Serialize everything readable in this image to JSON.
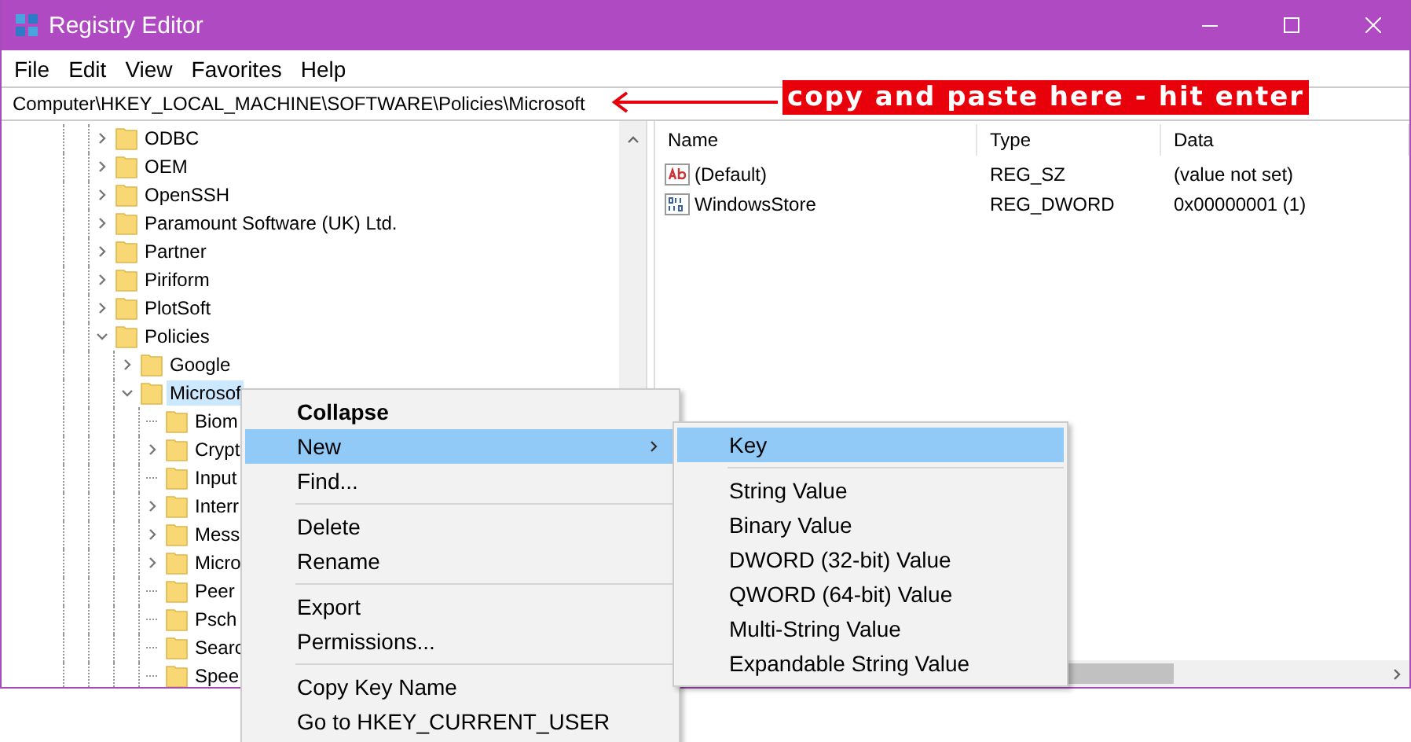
{
  "window": {
    "title": "Registry Editor"
  },
  "menu": [
    "File",
    "Edit",
    "View",
    "Favorites",
    "Help"
  ],
  "address": {
    "value": "Computer\\HKEY_LOCAL_MACHINE\\SOFTWARE\\Policies\\Microsoft"
  },
  "annotation": {
    "text": "copy and paste here - hit enter"
  },
  "tree": [
    {
      "label": "ODBC",
      "expandable": true,
      "expanded": false,
      "selected": false
    },
    {
      "label": "OEM",
      "expandable": true,
      "expanded": false,
      "selected": false
    },
    {
      "label": "OpenSSH",
      "expandable": true,
      "expanded": false,
      "selected": false
    },
    {
      "label": "Paramount Software (UK) Ltd.",
      "expandable": true,
      "expanded": false,
      "selected": false
    },
    {
      "label": "Partner",
      "expandable": true,
      "expanded": false,
      "selected": false
    },
    {
      "label": "Piriform",
      "expandable": true,
      "expanded": false,
      "selected": false
    },
    {
      "label": "PlotSoft",
      "expandable": true,
      "expanded": false,
      "selected": false
    },
    {
      "label": "Policies",
      "expandable": true,
      "expanded": true,
      "selected": false,
      "children": [
        {
          "label": "Google",
          "expandable": true,
          "expanded": false,
          "selected": false
        },
        {
          "label": "Microsof",
          "expandable": true,
          "expanded": true,
          "selected": true,
          "children": [
            {
              "label": "Biom",
              "expandable": false,
              "expanded": false,
              "selected": false
            },
            {
              "label": "Crypt",
              "expandable": true,
              "expanded": false,
              "selected": false
            },
            {
              "label": "Input",
              "expandable": false,
              "expanded": false,
              "selected": false
            },
            {
              "label": "Interr",
              "expandable": true,
              "expanded": false,
              "selected": false
            },
            {
              "label": "Mess",
              "expandable": true,
              "expanded": false,
              "selected": false
            },
            {
              "label": "Micro",
              "expandable": true,
              "expanded": false,
              "selected": false
            },
            {
              "label": "Peer",
              "expandable": false,
              "expanded": false,
              "selected": false
            },
            {
              "label": "Psch",
              "expandable": false,
              "expanded": false,
              "selected": false
            },
            {
              "label": "Searc",
              "expandable": false,
              "expanded": false,
              "selected": false
            },
            {
              "label": "Spee",
              "expandable": false,
              "expanded": false,
              "selected": false
            }
          ]
        }
      ]
    }
  ],
  "values": {
    "columns": [
      "Name",
      "Type",
      "Data"
    ],
    "rows": [
      {
        "kind": "string",
        "name": "(Default)",
        "type": "REG_SZ",
        "data": "(value not set)"
      },
      {
        "kind": "binary",
        "name": "WindowsStore",
        "type": "REG_DWORD",
        "data": "0x00000001 (1)"
      }
    ]
  },
  "context_menu": [
    {
      "kind": "item",
      "label": "Collapse",
      "default": true,
      "submenu": false,
      "selected": false
    },
    {
      "kind": "item",
      "label": "New",
      "default": false,
      "submenu": true,
      "selected": true
    },
    {
      "kind": "item",
      "label": "Find...",
      "default": false,
      "submenu": false,
      "selected": false
    },
    {
      "kind": "separator"
    },
    {
      "kind": "item",
      "label": "Delete",
      "default": false,
      "submenu": false,
      "selected": false
    },
    {
      "kind": "item",
      "label": "Rename",
      "default": false,
      "submenu": false,
      "selected": false
    },
    {
      "kind": "separator"
    },
    {
      "kind": "item",
      "label": "Export",
      "default": false,
      "submenu": false,
      "selected": false
    },
    {
      "kind": "item",
      "label": "Permissions...",
      "default": false,
      "submenu": false,
      "selected": false
    },
    {
      "kind": "separator"
    },
    {
      "kind": "item",
      "label": "Copy Key Name",
      "default": false,
      "submenu": false,
      "selected": false
    },
    {
      "kind": "item",
      "label": "Go to HKEY_CURRENT_USER",
      "default": false,
      "submenu": false,
      "selected": false
    }
  ],
  "submenu": [
    {
      "kind": "item",
      "label": "Key",
      "default": false,
      "submenu": false,
      "selected": true
    },
    {
      "kind": "separator"
    },
    {
      "kind": "item",
      "label": "String Value",
      "default": false,
      "submenu": false,
      "selected": false
    },
    {
      "kind": "item",
      "label": "Binary Value",
      "default": false,
      "submenu": false,
      "selected": false
    },
    {
      "kind": "item",
      "label": "DWORD (32-bit) Value",
      "default": false,
      "submenu": false,
      "selected": false
    },
    {
      "kind": "item",
      "label": "QWORD (64-bit) Value",
      "default": false,
      "submenu": false,
      "selected": false
    },
    {
      "kind": "item",
      "label": "Multi-String Value",
      "default": false,
      "submenu": false,
      "selected": false
    },
    {
      "kind": "item",
      "label": "Expandable String Value",
      "default": false,
      "submenu": false,
      "selected": false
    }
  ]
}
